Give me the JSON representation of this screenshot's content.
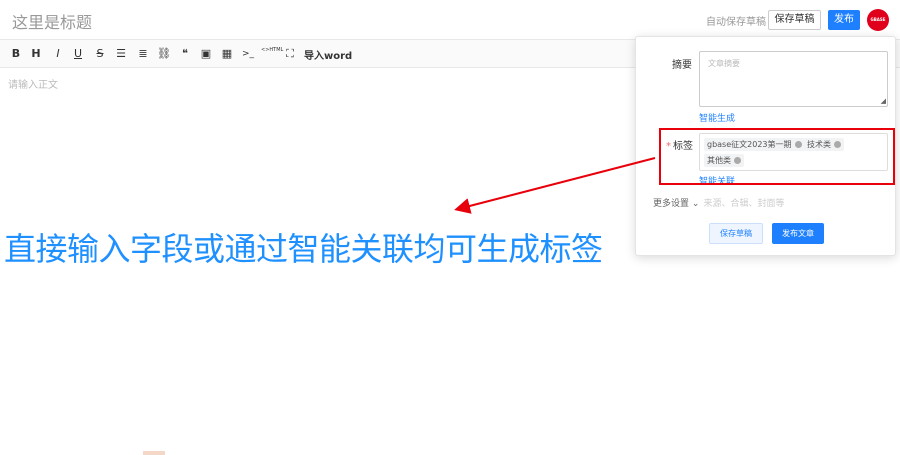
{
  "header": {
    "title_placeholder": "这里是标题",
    "autosave_label": "自动保存草稿",
    "save_draft_label": "保存草稿",
    "publish_label": "发布",
    "avatar_text": "GBASE"
  },
  "toolbar": {
    "icons": [
      {
        "name": "bold-icon",
        "glyph": "B"
      },
      {
        "name": "heading-icon",
        "glyph": "H"
      },
      {
        "name": "italic-icon",
        "glyph": "I"
      },
      {
        "name": "underline-icon",
        "glyph": "U"
      },
      {
        "name": "strikethrough-icon",
        "glyph": "S"
      },
      {
        "name": "unordered-list-icon",
        "glyph": "☰"
      },
      {
        "name": "ordered-list-icon",
        "glyph": "≣"
      },
      {
        "name": "link-icon",
        "glyph": "⛓"
      },
      {
        "name": "quote-icon",
        "glyph": "❝"
      },
      {
        "name": "image-icon",
        "glyph": "▣"
      },
      {
        "name": "table-icon",
        "glyph": "▦"
      },
      {
        "name": "code-icon",
        "glyph": ">_"
      },
      {
        "name": "html-icon",
        "glyph": "<>HTML"
      },
      {
        "name": "fullscreen-icon",
        "glyph": "⛶"
      }
    ],
    "import_label": "导入word"
  },
  "editor": {
    "body_placeholder": "请输入正文"
  },
  "publish_panel": {
    "summary_label": "摘要",
    "summary_placeholder": "文章摘要",
    "smart_generate_link": "智能生成",
    "tags_label": "标签",
    "required_mark": "*",
    "tags": [
      "gbase征文2023第一期",
      "技术类",
      "其他类"
    ],
    "smart_associate_link": "智能关联",
    "more_settings_label": "更多设置",
    "more_settings_hint": "来源、合辑、封面等",
    "save_draft_label": "保存草稿",
    "publish_article_label": "发布文章"
  },
  "annotation": {
    "text": "直接输入字段或通过智能关联均可生成标签",
    "color": "#1e90ff",
    "arrow_color": "#e8000b"
  }
}
